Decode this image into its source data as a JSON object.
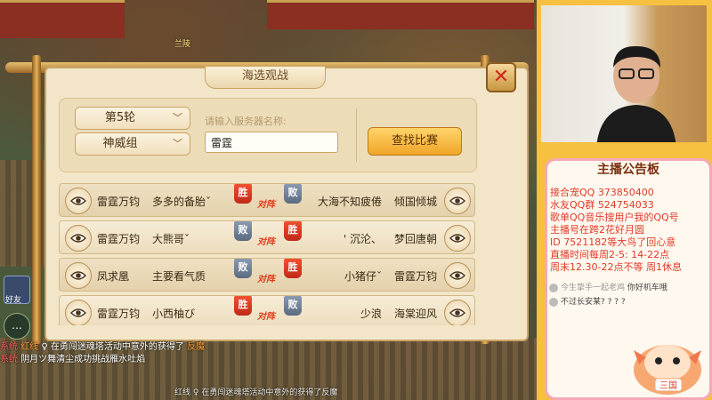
{
  "game": {
    "character_name": "兰陵",
    "dialog_title": "海选观战",
    "round_select": "第5轮",
    "group_select": "神威组",
    "server_label": "请输入服务器名称:",
    "server_input_value": "雷霆",
    "search_button": "查找比赛",
    "vs_label": "对阵",
    "matches": [
      {
        "left_server": "雷霆万钧",
        "left_player": "多多的备胎ˇ",
        "left_result": "胜",
        "right_result": "败",
        "right_player": "大海不知疲倦",
        "right_server": "倾国倾城"
      },
      {
        "left_server": "雷霆万钧",
        "left_player": "大熊哥ˇ",
        "left_result": "败",
        "right_result": "胜",
        "right_player": "' 沉沦、",
        "right_server": "梦回唐朝"
      },
      {
        "left_server": "凤求凰",
        "left_player": "主要看气质",
        "left_result": "败",
        "right_result": "胜",
        "right_player": "小猪仔ˇ",
        "right_server": "雷霆万钧"
      },
      {
        "left_server": "雷霆万钧",
        "left_player": "小西柚び",
        "left_result": "胜",
        "right_result": "败",
        "right_player": "少浪",
        "right_server": "海棠迎风"
      }
    ],
    "side_label": "好友",
    "chat": [
      {
        "tag": "系统",
        "pre": "红线 ",
        "mid": "♀ 在勇闯迷魂塔活动中意外的获得了",
        "item": "反魔"
      },
      {
        "tag": "系统",
        "pre": "",
        "mid": "阴月ツ舞清尘成功挑战雁水吐焰",
        "item": ""
      }
    ],
    "bottom_message": "红线 ♀ 在勇闯迷魂塔活动中意外的获得了反魔"
  },
  "stream": {
    "board_title": "主播公告板",
    "board_lines": [
      "接合宠QQ 373850400",
      "水友QQ群 524754033",
      "歌单QQ音乐搜用户我的QQ号",
      "主播号在跨2花好月圆",
      "ID 7521182等大鸟了回心意",
      "直播时间每周2-5: 14-22点",
      "周末12.30-22点不等 周1休息"
    ],
    "comments": [
      {
        "user": "今生挚手一起老鸡",
        "text": "你好机车哦"
      },
      {
        "user": "",
        "text": "不过长安某? ? ? ?"
      }
    ],
    "mascot_label": "三国"
  },
  "colors": {
    "win_red": "#c02818",
    "lose_gray": "#5a6a80",
    "accent_gold": "#f0a528",
    "board_text_red": "#e03a2a"
  },
  "icons": [
    "eye-icon",
    "close-icon",
    "chevron-down-icon"
  ]
}
